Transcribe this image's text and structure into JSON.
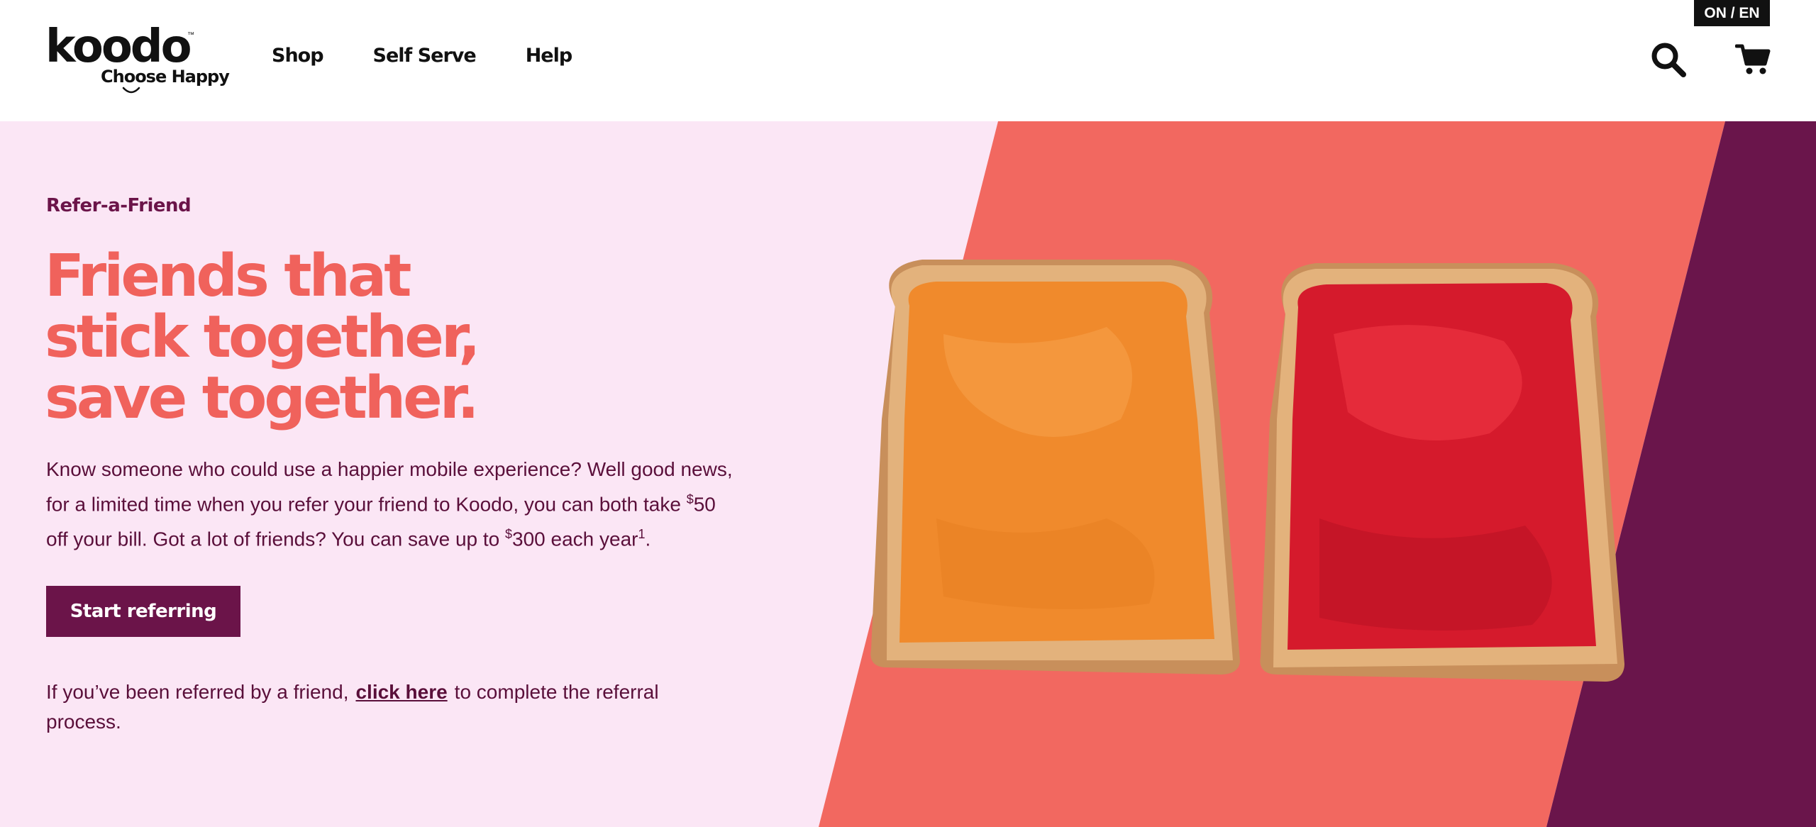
{
  "header": {
    "logo_word": "koodo",
    "logo_tagline": "Choose Happy",
    "logo_tm": "™",
    "lang_toggle": "ON / EN",
    "nav": [
      {
        "label": "Shop"
      },
      {
        "label": "Self Serve"
      },
      {
        "label": "Help"
      }
    ],
    "icons": {
      "search": "search-icon",
      "cart": "cart-icon"
    }
  },
  "hero": {
    "eyebrow": "Refer-a-Friend",
    "headline": [
      "Friends that",
      "stick together,",
      "save together."
    ],
    "body": {
      "part1": "Know someone who could use a happier mobile experience? Well good news, for a limited time when you refer your friend to Koodo, you can both take ",
      "currency_1": "$",
      "amount_1": "50",
      "part2": " off your bill. Got a lot of friends? You can save up to ",
      "currency_2": "$",
      "amount_2": "300",
      "part3": " each year",
      "footnote": "1",
      "part4": "."
    },
    "cta_label": "Start referring",
    "referred": {
      "before": "If you’ve been referred by a friend,",
      "link": "click here",
      "after": "to complete the referral process."
    }
  },
  "colors": {
    "brand_plum": "#6b1449",
    "coral": "#f0625c",
    "pink_bg": "#fbe6f5",
    "dark_plum_panel": "#6a154b"
  }
}
